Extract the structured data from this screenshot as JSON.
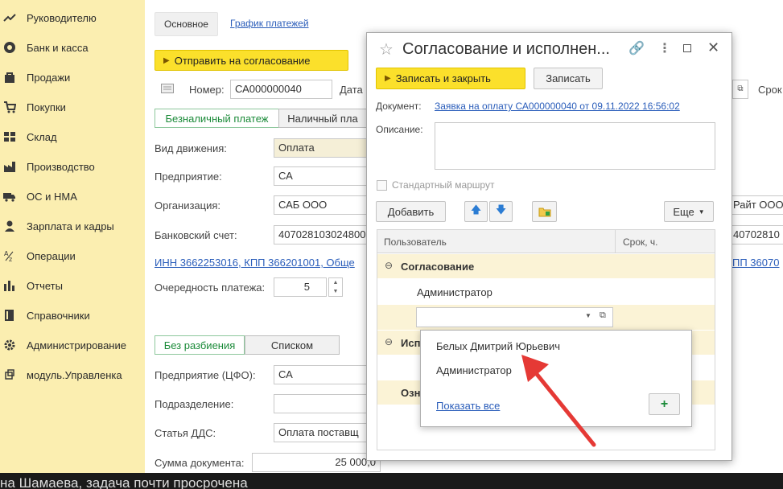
{
  "sidebar": {
    "items": [
      {
        "label": "Руководителю",
        "icon": "trend-icon"
      },
      {
        "label": "Банк и касса",
        "icon": "coin-icon"
      },
      {
        "label": "Продажи",
        "icon": "bag-icon"
      },
      {
        "label": "Покупки",
        "icon": "cart-icon"
      },
      {
        "label": "Склад",
        "icon": "warehouse-icon"
      },
      {
        "label": "Производство",
        "icon": "factory-icon"
      },
      {
        "label": "ОС и НМА",
        "icon": "truck-icon"
      },
      {
        "label": "Зарплата и кадры",
        "icon": "person-icon"
      },
      {
        "label": "Операции",
        "icon": "operations-icon"
      },
      {
        "label": "Отчеты",
        "icon": "bar-chart-icon"
      },
      {
        "label": "Справочники",
        "icon": "book-icon"
      },
      {
        "label": "Администрирование",
        "icon": "gear-icon"
      },
      {
        "label": "модуль.Управленка",
        "icon": "module-icon"
      }
    ]
  },
  "main": {
    "tab_main": "Основное",
    "tab_schedule": "График платежей",
    "send_button": "Отправить на согласование",
    "number_label": "Номер:",
    "number_value": "СА000000040",
    "date_label": "Дата",
    "right_partial_label": "Срок",
    "seg_cashless": "Безналичный платеж",
    "seg_cash": "Наличный пла",
    "movement_label": "Вид движения:",
    "movement_value": "Оплата",
    "enterprise_label": "Предприятие:",
    "enterprise_value": "СА",
    "org_label": "Организация:",
    "org_value": "САБ ООО",
    "right_org_partial": "Райт ООО",
    "bank_label": "Банковский счет:",
    "bank_value": "407028103024800",
    "right_bank_partial": "40702810",
    "inn_link": "ИНН 3662253016, КПП 366201001, Обще",
    "right_inn_partial": "ПП 36070",
    "priority_label": "Очередность платежа:",
    "priority_value": "5",
    "seg_nosplit": "Без разбиения",
    "seg_list": "Списком",
    "cfo_label": "Предприятие (ЦФО):",
    "cfo_value": "СА",
    "dept_label": "Подразделение:",
    "dds_label": "Статья ДДС:",
    "dds_value": "Оплата поставщ",
    "sum_label": "Сумма документа:",
    "sum_value": "25 000,0"
  },
  "dialog": {
    "title": "Согласование и исполнен...",
    "save_close_button": "Записать и закрыть",
    "save_button": "Записать",
    "document_label": "Документ:",
    "document_link": "Заявка на оплату СА000000040 от 09.11.2022 16:56:02",
    "description_label": "Описание:",
    "standard_route_label": "Стандартный маршрут",
    "add_button": "Добавить",
    "more_button": "Еще",
    "col_user": "Пользователь",
    "col_term": "Срок, ч.",
    "group_approval": "Согласование",
    "row_admin": "Администратор",
    "group_exec_partial": "Исп",
    "group_ack_partial": "Озн"
  },
  "dropdown": {
    "items": [
      "Белых Дмитрий Юрьевич",
      "Администратор"
    ],
    "show_all": "Показать все"
  },
  "bottom_text": "на Шамаева, задача почти просрочена",
  "colors": {
    "sidebar_bg": "#fbeeb0",
    "accent_yellow": "#fbe02b",
    "link": "#2a5dba",
    "group_row": "#fbf3d6",
    "arrow_red": "#e53935"
  }
}
